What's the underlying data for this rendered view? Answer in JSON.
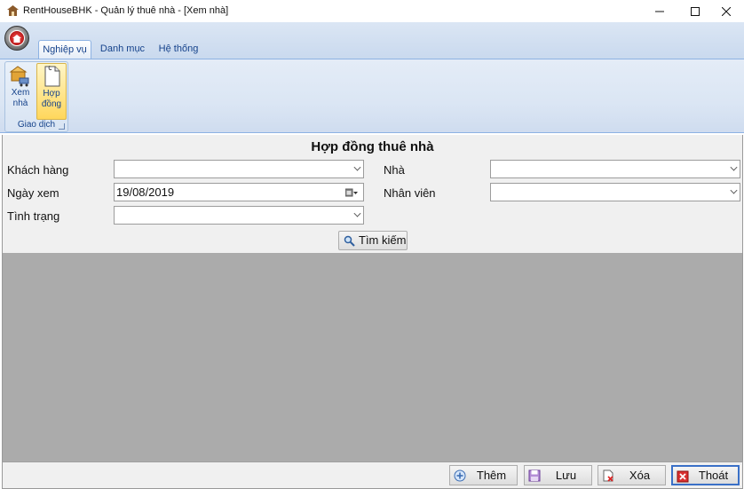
{
  "window": {
    "title": "RentHouseBHK - Quản lý thuê nhà - [Xem nhà]",
    "minimize_icon": "minimize-icon",
    "maximize_icon": "maximize-icon",
    "close_icon": "close-icon"
  },
  "ribbon": {
    "tabs": [
      {
        "label": "Nghiệp vụ",
        "active": true
      },
      {
        "label": "Danh mục",
        "active": false
      },
      {
        "label": "Hệ thống",
        "active": false
      }
    ],
    "group": {
      "label": "Giao dịch",
      "buttons": [
        {
          "label_line1": "Xem",
          "label_line2": "nhà",
          "icon": "house-cart-icon",
          "selected": false
        },
        {
          "label_line1": "Hợp",
          "label_line2": "đồng",
          "icon": "document-icon",
          "selected": true
        }
      ]
    }
  },
  "form": {
    "title": "Hợp đồng thuê nhà",
    "customer_label": "Khách hàng",
    "customer_value": "",
    "house_label": "Nhà",
    "house_value": "",
    "date_label": "Ngày xem",
    "date_value": "19/08/2019",
    "staff_label": "Nhân viên",
    "staff_value": "",
    "status_label": "Tình trạng",
    "status_value": "",
    "search_button": "Tìm kiếm"
  },
  "bottom": {
    "add_label": "Thêm",
    "save_label": "Lưu",
    "delete_label": "Xóa",
    "exit_label": "Thoát"
  },
  "colors": {
    "grid_background": "#ababab",
    "ribbon_text": "#15428b",
    "focus_border": "#3a70c7"
  }
}
